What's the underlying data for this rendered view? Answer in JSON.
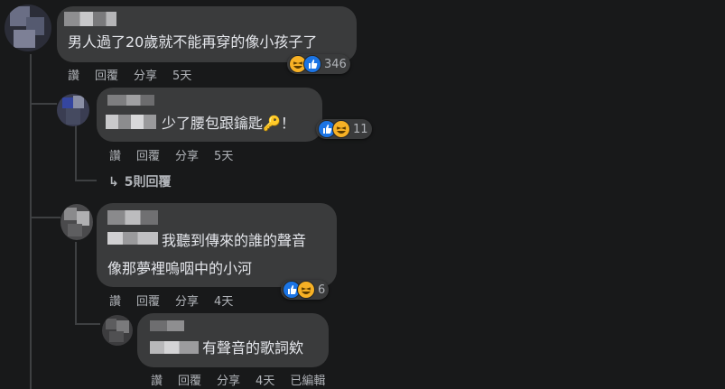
{
  "comments": [
    {
      "text": "男人過了20歲就不能再穿的像小孩子了",
      "actions": [
        "讚",
        "回覆",
        "分享",
        "5天"
      ],
      "reaction_count": "346",
      "reactions": [
        "haha",
        "like"
      ]
    },
    {
      "text": "少了腰包跟鑰匙🔑！",
      "actions": [
        "讚",
        "回覆",
        "分享",
        "5天"
      ],
      "reaction_count": "11",
      "reactions": [
        "like",
        "haha"
      ],
      "more_replies": "5則回覆"
    },
    {
      "lines": [
        "我聽到傳來的誰的聲音",
        "像那夢裡嗚咽中的小河"
      ],
      "actions": [
        "讚",
        "回覆",
        "分享",
        "4天"
      ],
      "reaction_count": "6",
      "reactions": [
        "like",
        "haha"
      ]
    },
    {
      "text": "有聲音的歌詞欸",
      "actions": [
        "讚",
        "回覆",
        "分享",
        "4天",
        "已編輯"
      ]
    }
  ],
  "icons": {
    "reply_arrow": "reply-arrow-icon",
    "like": "like-icon",
    "haha": "haha-icon"
  },
  "colors": {
    "background": "#18191a",
    "bubble": "#3a3b3c",
    "like": "#1b74e4",
    "haha": "#f7b125"
  }
}
